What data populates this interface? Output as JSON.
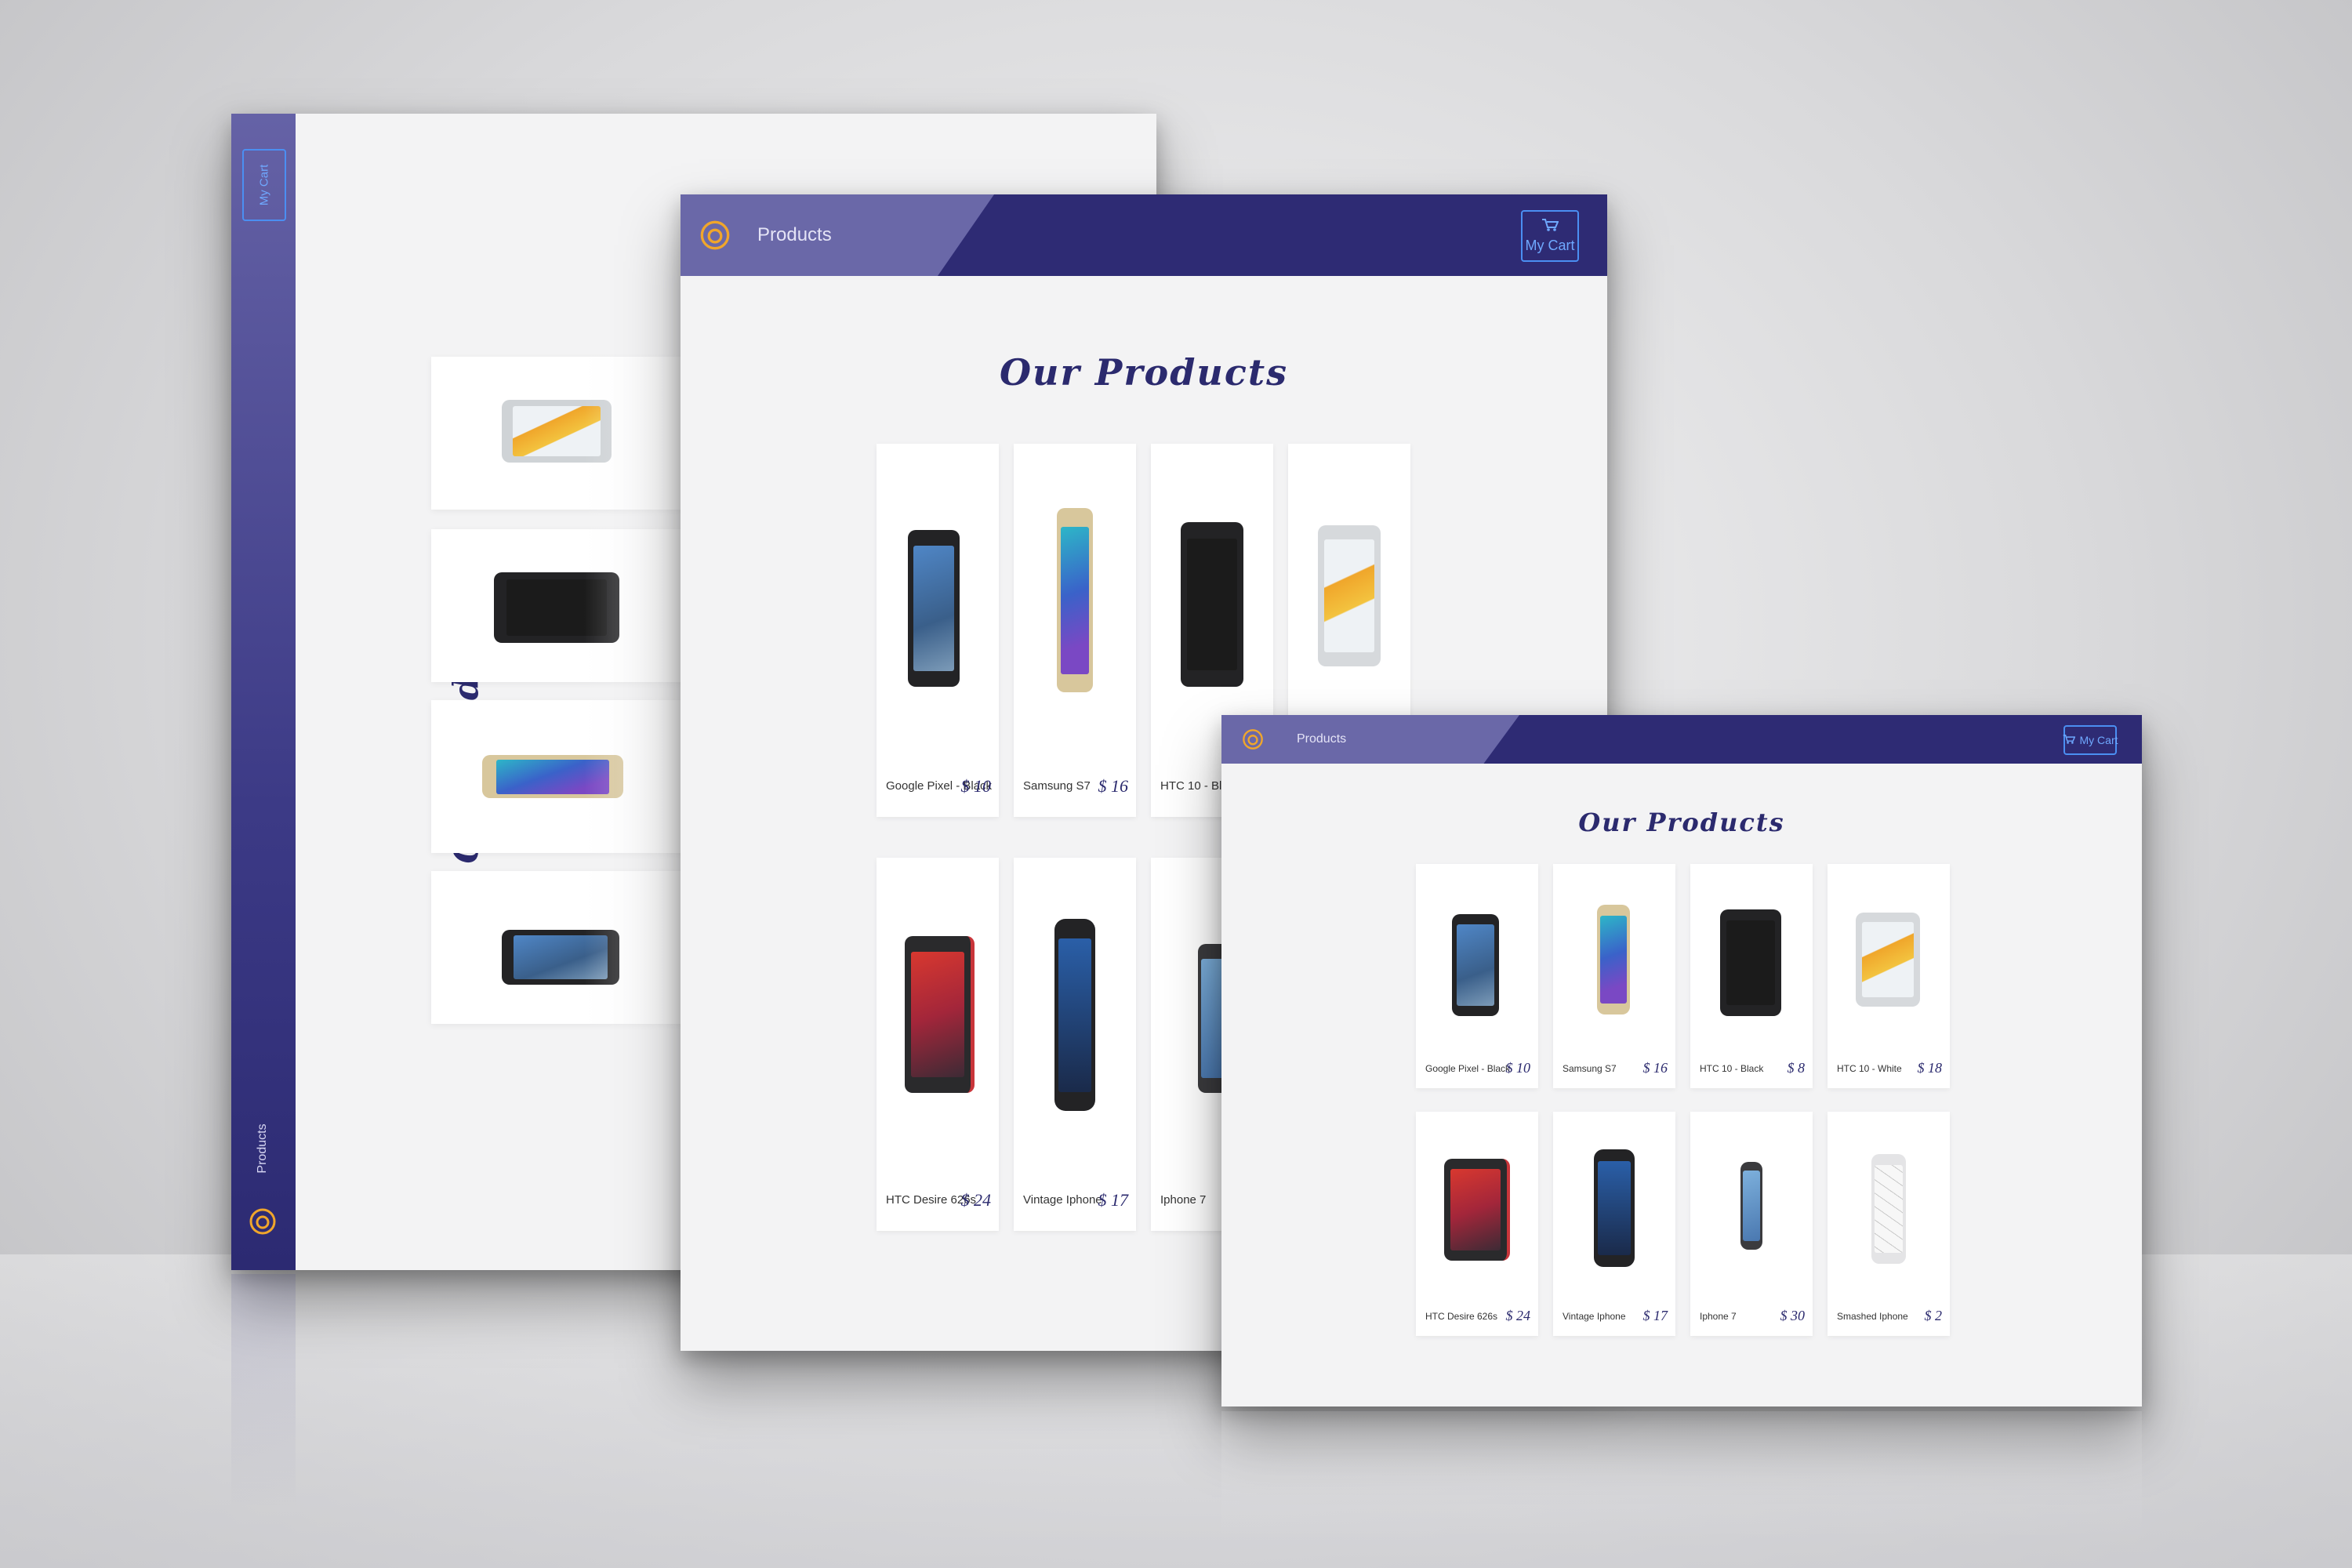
{
  "app": {
    "heading": "Our Products",
    "nav_label": "Products",
    "cart_label": "My Cart",
    "icons": {
      "logo": "logo-icon",
      "cart": "cart-icon"
    },
    "colors": {
      "primary": "#2e2b74",
      "primary_light": "#6a68a8",
      "cart_accent": "#4b8ff2",
      "price": "#2b2a6e"
    }
  },
  "products": [
    {
      "name": "Google Pixel - Black",
      "price": "$ 10"
    },
    {
      "name": "Samsung S7",
      "price": "$ 16"
    },
    {
      "name": "HTC 10 - Black",
      "price": "$ 8"
    },
    {
      "name": "HTC 10 - White",
      "price": "$ 18"
    },
    {
      "name": "HTC Desire 626s",
      "price": "$ 24"
    },
    {
      "name": "Vintage Iphone",
      "price": "$ 17"
    },
    {
      "name": "Iphone 7",
      "price": "$ 30"
    },
    {
      "name": "Smashed Iphone",
      "price": "$ 2"
    }
  ]
}
